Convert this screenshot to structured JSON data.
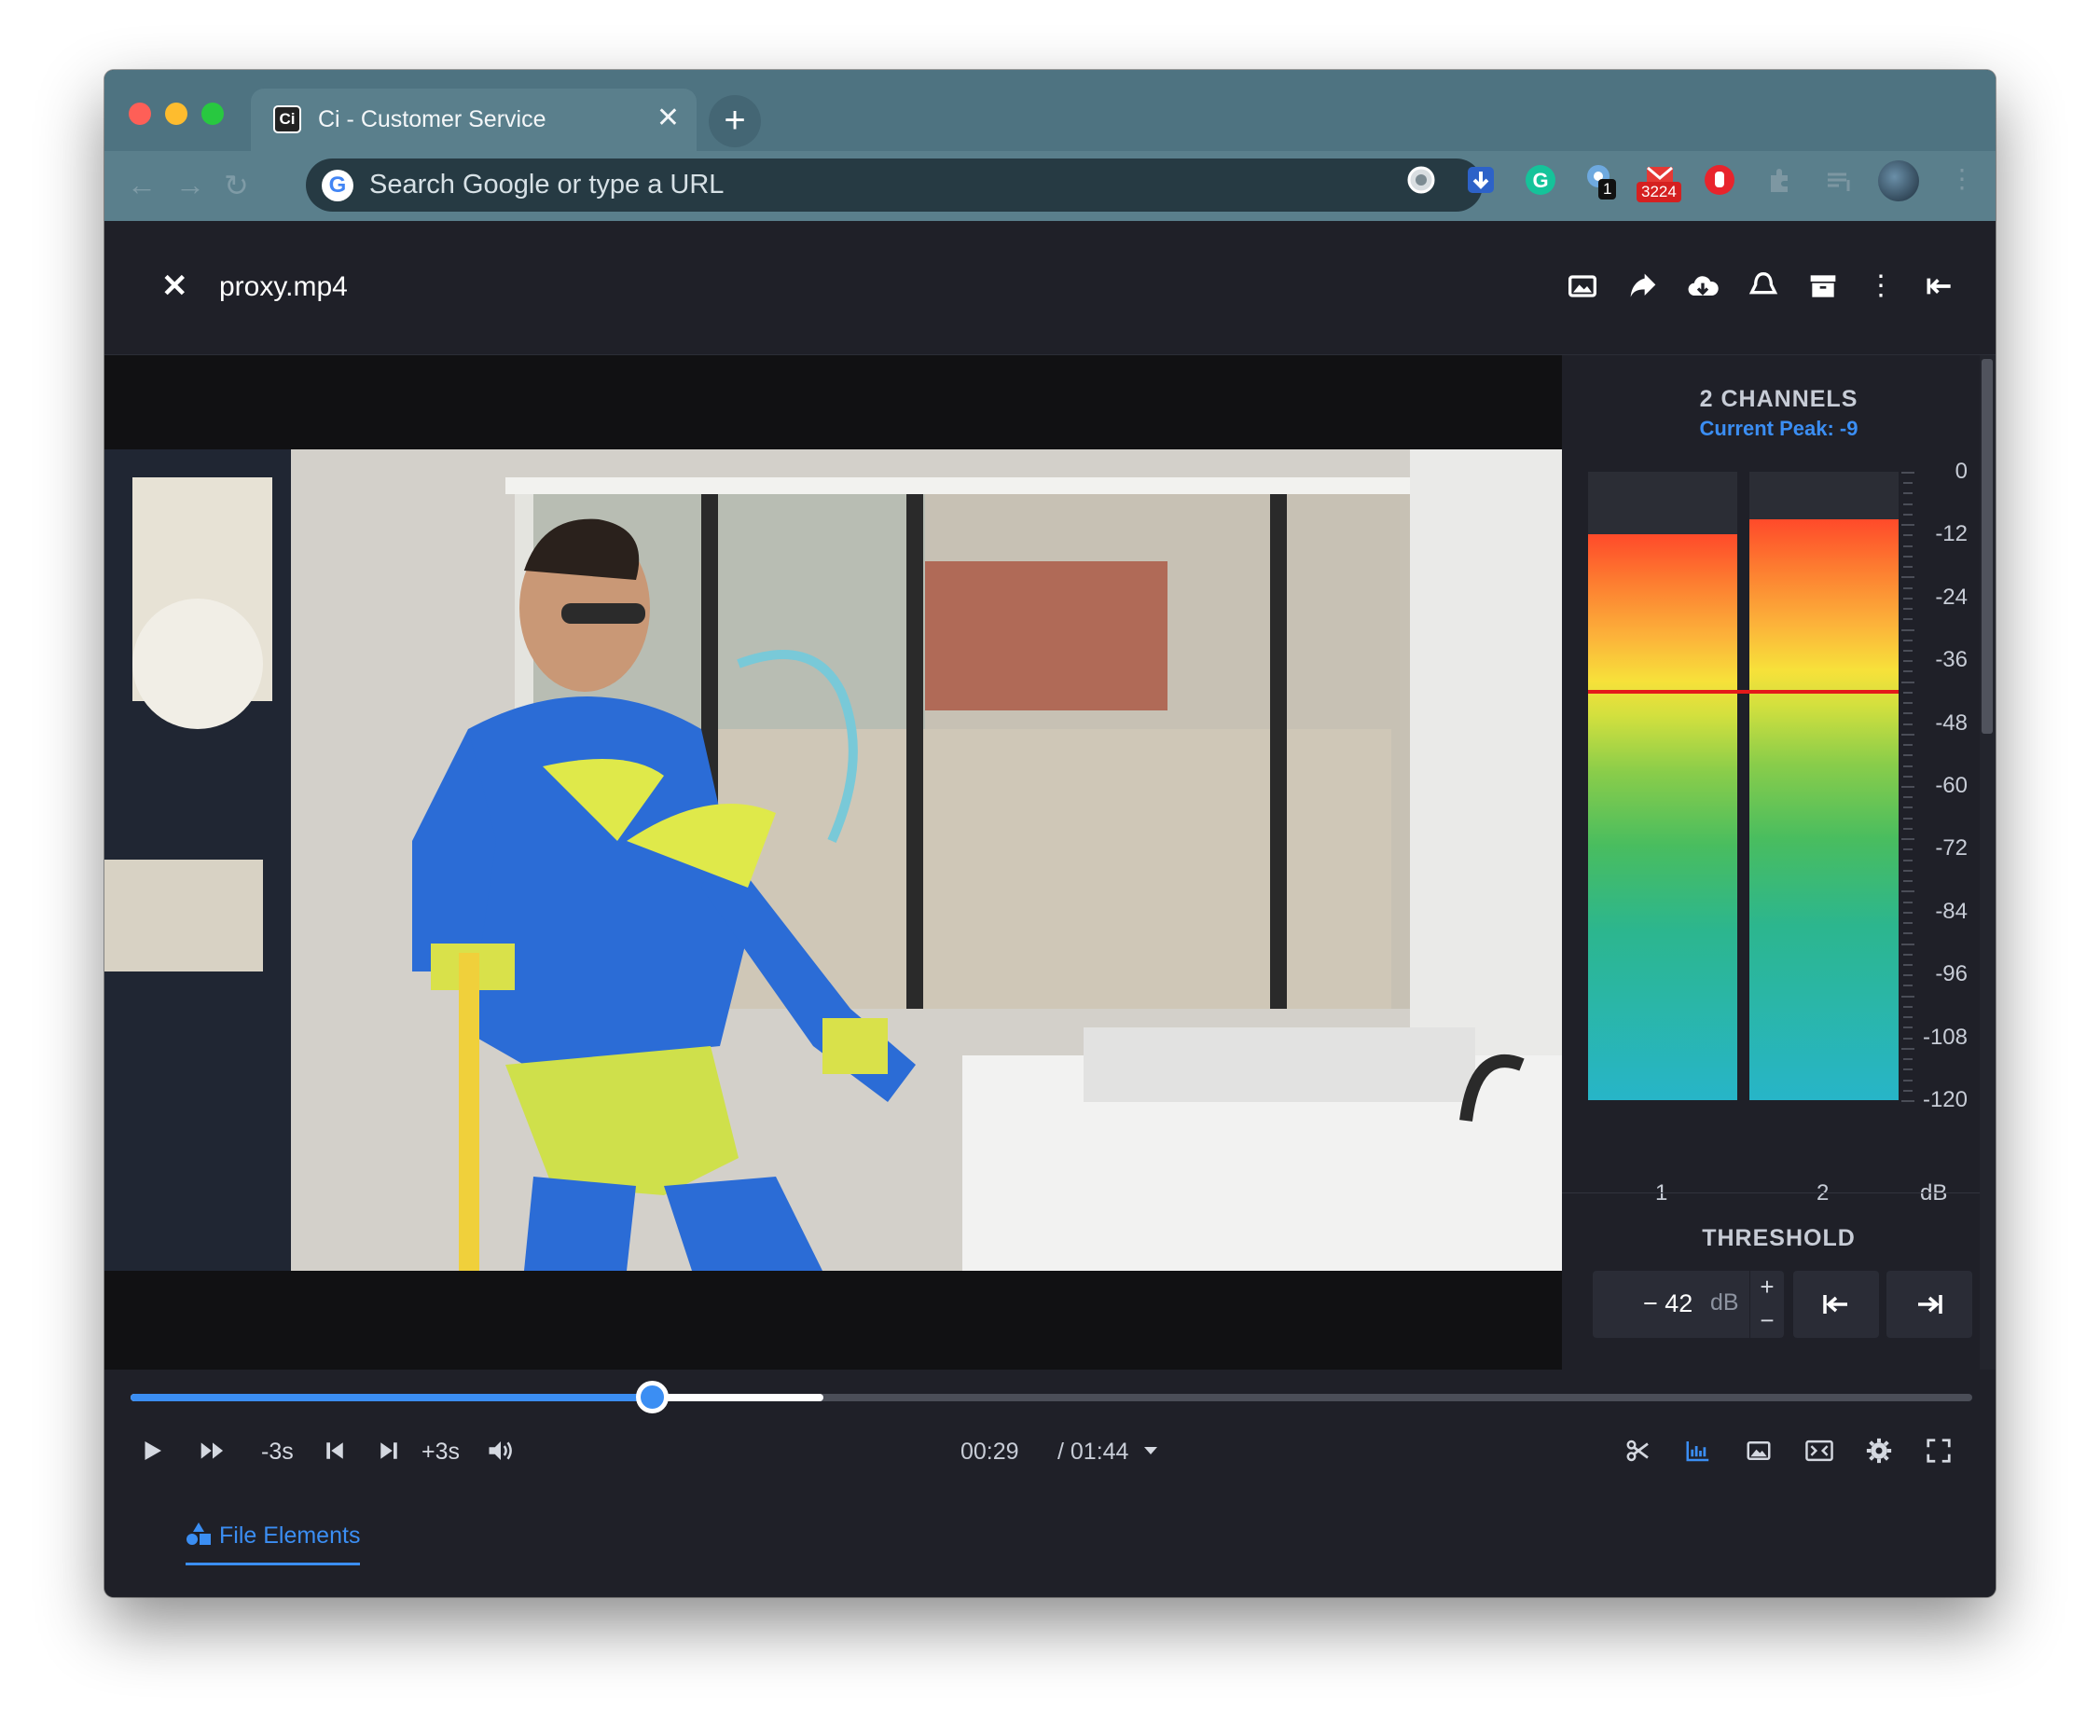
{
  "browser": {
    "tab_title": "Ci - Customer Service",
    "tab_favicon": "Ci",
    "address_placeholder": "Search Google or type a URL",
    "extensions": [
      {
        "icon": "circle-extension-icon"
      },
      {
        "icon": "download-extension-icon"
      },
      {
        "icon": "grammarly-icon",
        "glyph": "G"
      },
      {
        "icon": "puzzle-badge-icon",
        "badge": "1"
      },
      {
        "icon": "gmail-icon",
        "badge": "3224"
      },
      {
        "icon": "stop-hand-icon"
      },
      {
        "icon": "extensions-icon"
      },
      {
        "icon": "media-queue-icon"
      },
      {
        "icon": "profile-avatar"
      }
    ]
  },
  "viewer": {
    "file_name": "proxy.mp4",
    "header_actions": [
      "image-icon",
      "share-icon",
      "cloud-download-icon",
      "bell-icon",
      "archive-icon",
      "more-vert-icon",
      "collapse-icon"
    ]
  },
  "meter": {
    "title": "2 CHANNELS",
    "current_peak": "Current Peak: -9",
    "scale": [
      "0",
      "-12",
      "-24",
      "-36",
      "-48",
      "-60",
      "-72",
      "-84",
      "-96",
      "-108",
      "-120"
    ],
    "unit_label": "dB",
    "channels": [
      {
        "label": "1",
        "level_db": -12
      },
      {
        "label": "2",
        "level_db": -9
      }
    ],
    "threshold_db": -42
  },
  "threshold": {
    "title": "THRESHOLD",
    "value": "− 42",
    "unit": "dB",
    "plus": "+",
    "minus": "−"
  },
  "player": {
    "back_label": "-3s",
    "forward_label": "+3s",
    "current_time": "00:29",
    "duration": "/ 01:44",
    "progress_fraction": 0.283,
    "buffered_fraction": 0.376
  },
  "bottom_tabs": {
    "active": "File Elements"
  },
  "colors": {
    "accent": "#3b8ef3",
    "background": "#1f2028",
    "threshold_line": "#e41a1a"
  }
}
